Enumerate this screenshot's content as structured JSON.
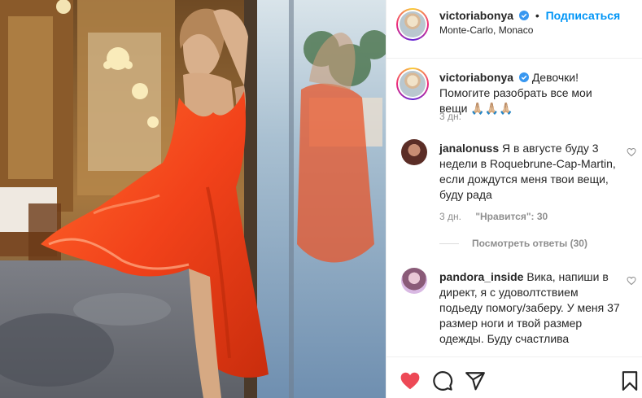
{
  "post": {
    "username": "victoriabonya",
    "follow_label": "Подписаться",
    "separator": "•",
    "location": "Monte-Carlo, Monaco"
  },
  "caption": {
    "username": "victoriabonya",
    "text": "Девочки! Помогите разобрать все мои вещи 🙏🏼🙏🏼🙏🏼",
    "time": "3 дн."
  },
  "comments": [
    {
      "username": "janalonuss",
      "text": "Я в августе буду 3 недели в Roquebrune-Cap-Martin, если дождутся меня твои вещи, буду рада",
      "time": "3 дн.",
      "likes": "\"Нравится\": 30",
      "replies": "Посмотреть ответы (30)"
    },
    {
      "username": "pandora_inside",
      "text": "Вика, напиши в директ, я с удоволтствием подьеду помогу/заберу. У меня 37 размер ноги и твой размер одежды. Буду счастлива"
    }
  ],
  "icons": {
    "like": "heart-filled-icon",
    "comment": "speech-bubble-icon",
    "share": "paper-plane-icon",
    "save": "bookmark-icon",
    "verified": "verified-badge-icon",
    "comment_like": "heart-outline-icon"
  },
  "colors": {
    "accent": "#0095f6",
    "like": "#ed4956",
    "text": "#262626",
    "muted": "#8e8e8e",
    "dress": "#f2421a"
  }
}
